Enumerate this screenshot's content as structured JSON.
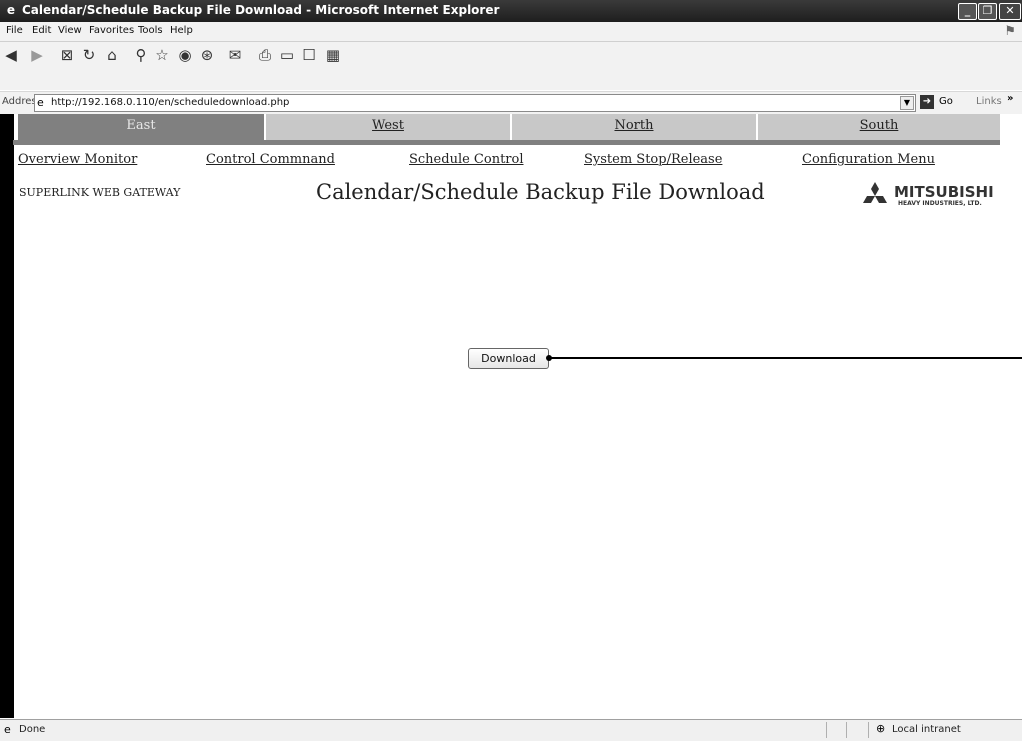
{
  "window": {
    "title": "Calendar/Schedule Backup File Download - Microsoft Internet Explorer"
  },
  "menu": [
    "File",
    "Edit",
    "View",
    "Favorites",
    "Tools",
    "Help"
  ],
  "address": {
    "label": "Address",
    "url": "http://192.168.0.110/en/scheduledownload.php",
    "go_label": "Go",
    "links_label": "Links"
  },
  "zones": [
    "East",
    "West",
    "North",
    "South"
  ],
  "nav": [
    "Overview Monitor",
    "Control Commnand",
    "Schedule Control",
    "System Stop/Release",
    "Configuration Menu"
  ],
  "header": {
    "brand": "SUPERLINK WEB GATEWAY",
    "page_title": "Calendar/Schedule Backup File Download",
    "logo_name": "MITSUBISHI",
    "logo_sub": "HEAVY INDUSTRIES, LTD."
  },
  "download_button": "Download",
  "status": {
    "text": "Done",
    "zone": "Local intranet"
  }
}
